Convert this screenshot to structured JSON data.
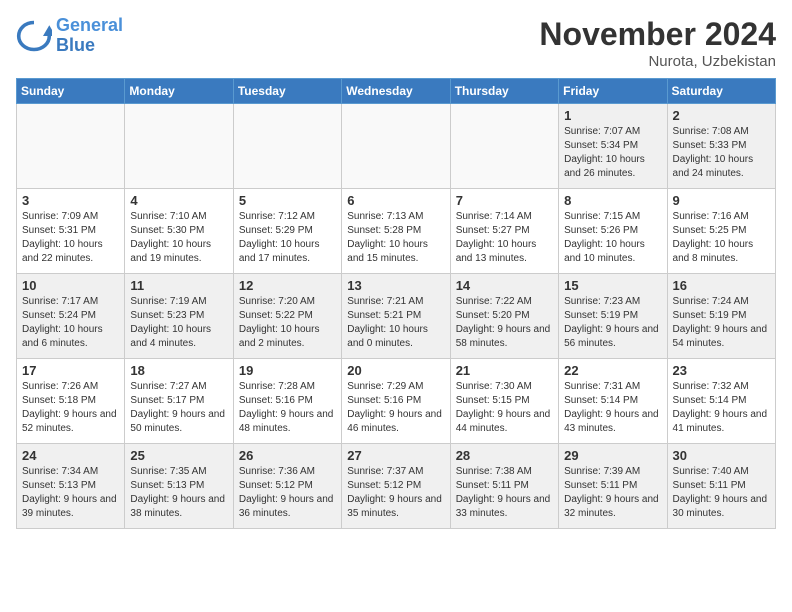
{
  "app": {
    "name": "GeneralBlue",
    "logo_line1": "General",
    "logo_line2": "Blue"
  },
  "calendar": {
    "month": "November 2024",
    "location": "Nurota, Uzbekistan",
    "weekdays": [
      "Sunday",
      "Monday",
      "Tuesday",
      "Wednesday",
      "Thursday",
      "Friday",
      "Saturday"
    ],
    "weeks": [
      [
        {
          "day": "",
          "info": ""
        },
        {
          "day": "",
          "info": ""
        },
        {
          "day": "",
          "info": ""
        },
        {
          "day": "",
          "info": ""
        },
        {
          "day": "",
          "info": ""
        },
        {
          "day": "1",
          "info": "Sunrise: 7:07 AM\nSunset: 5:34 PM\nDaylight: 10 hours and 26 minutes."
        },
        {
          "day": "2",
          "info": "Sunrise: 7:08 AM\nSunset: 5:33 PM\nDaylight: 10 hours and 24 minutes."
        }
      ],
      [
        {
          "day": "3",
          "info": "Sunrise: 7:09 AM\nSunset: 5:31 PM\nDaylight: 10 hours and 22 minutes."
        },
        {
          "day": "4",
          "info": "Sunrise: 7:10 AM\nSunset: 5:30 PM\nDaylight: 10 hours and 19 minutes."
        },
        {
          "day": "5",
          "info": "Sunrise: 7:12 AM\nSunset: 5:29 PM\nDaylight: 10 hours and 17 minutes."
        },
        {
          "day": "6",
          "info": "Sunrise: 7:13 AM\nSunset: 5:28 PM\nDaylight: 10 hours and 15 minutes."
        },
        {
          "day": "7",
          "info": "Sunrise: 7:14 AM\nSunset: 5:27 PM\nDaylight: 10 hours and 13 minutes."
        },
        {
          "day": "8",
          "info": "Sunrise: 7:15 AM\nSunset: 5:26 PM\nDaylight: 10 hours and 10 minutes."
        },
        {
          "day": "9",
          "info": "Sunrise: 7:16 AM\nSunset: 5:25 PM\nDaylight: 10 hours and 8 minutes."
        }
      ],
      [
        {
          "day": "10",
          "info": "Sunrise: 7:17 AM\nSunset: 5:24 PM\nDaylight: 10 hours and 6 minutes."
        },
        {
          "day": "11",
          "info": "Sunrise: 7:19 AM\nSunset: 5:23 PM\nDaylight: 10 hours and 4 minutes."
        },
        {
          "day": "12",
          "info": "Sunrise: 7:20 AM\nSunset: 5:22 PM\nDaylight: 10 hours and 2 minutes."
        },
        {
          "day": "13",
          "info": "Sunrise: 7:21 AM\nSunset: 5:21 PM\nDaylight: 10 hours and 0 minutes."
        },
        {
          "day": "14",
          "info": "Sunrise: 7:22 AM\nSunset: 5:20 PM\nDaylight: 9 hours and 58 minutes."
        },
        {
          "day": "15",
          "info": "Sunrise: 7:23 AM\nSunset: 5:19 PM\nDaylight: 9 hours and 56 minutes."
        },
        {
          "day": "16",
          "info": "Sunrise: 7:24 AM\nSunset: 5:19 PM\nDaylight: 9 hours and 54 minutes."
        }
      ],
      [
        {
          "day": "17",
          "info": "Sunrise: 7:26 AM\nSunset: 5:18 PM\nDaylight: 9 hours and 52 minutes."
        },
        {
          "day": "18",
          "info": "Sunrise: 7:27 AM\nSunset: 5:17 PM\nDaylight: 9 hours and 50 minutes."
        },
        {
          "day": "19",
          "info": "Sunrise: 7:28 AM\nSunset: 5:16 PM\nDaylight: 9 hours and 48 minutes."
        },
        {
          "day": "20",
          "info": "Sunrise: 7:29 AM\nSunset: 5:16 PM\nDaylight: 9 hours and 46 minutes."
        },
        {
          "day": "21",
          "info": "Sunrise: 7:30 AM\nSunset: 5:15 PM\nDaylight: 9 hours and 44 minutes."
        },
        {
          "day": "22",
          "info": "Sunrise: 7:31 AM\nSunset: 5:14 PM\nDaylight: 9 hours and 43 minutes."
        },
        {
          "day": "23",
          "info": "Sunrise: 7:32 AM\nSunset: 5:14 PM\nDaylight: 9 hours and 41 minutes."
        }
      ],
      [
        {
          "day": "24",
          "info": "Sunrise: 7:34 AM\nSunset: 5:13 PM\nDaylight: 9 hours and 39 minutes."
        },
        {
          "day": "25",
          "info": "Sunrise: 7:35 AM\nSunset: 5:13 PM\nDaylight: 9 hours and 38 minutes."
        },
        {
          "day": "26",
          "info": "Sunrise: 7:36 AM\nSunset: 5:12 PM\nDaylight: 9 hours and 36 minutes."
        },
        {
          "day": "27",
          "info": "Sunrise: 7:37 AM\nSunset: 5:12 PM\nDaylight: 9 hours and 35 minutes."
        },
        {
          "day": "28",
          "info": "Sunrise: 7:38 AM\nSunset: 5:11 PM\nDaylight: 9 hours and 33 minutes."
        },
        {
          "day": "29",
          "info": "Sunrise: 7:39 AM\nSunset: 5:11 PM\nDaylight: 9 hours and 32 minutes."
        },
        {
          "day": "30",
          "info": "Sunrise: 7:40 AM\nSunset: 5:11 PM\nDaylight: 9 hours and 30 minutes."
        }
      ]
    ]
  }
}
